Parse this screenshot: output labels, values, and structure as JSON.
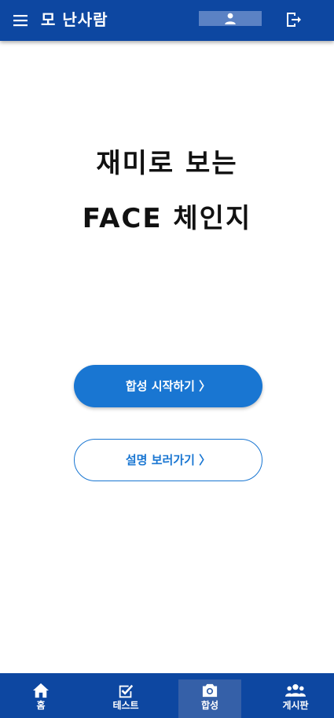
{
  "app": {
    "title": "모 난사람"
  },
  "header": {
    "menu_icon": "menu-icon",
    "profile_icon": "person-icon",
    "logout_icon": "logout-icon"
  },
  "hero": {
    "line1": "재미로 보는",
    "line2": "FACE 체인지"
  },
  "actions": {
    "start_label": "합성 시작하기 〉",
    "explain_label": "설명 보러가기 〉"
  },
  "bottom_nav": {
    "items": [
      {
        "label": "홈",
        "icon": "home-icon"
      },
      {
        "label": "테스트",
        "icon": "checkbox-icon"
      },
      {
        "label": "합성",
        "icon": "camera-icon",
        "active": true
      },
      {
        "label": "게시판",
        "icon": "group-icon"
      }
    ]
  },
  "colors": {
    "primary_dark": "#0d47a1",
    "primary": "#1976d2",
    "active_tab": "#3560a8"
  }
}
